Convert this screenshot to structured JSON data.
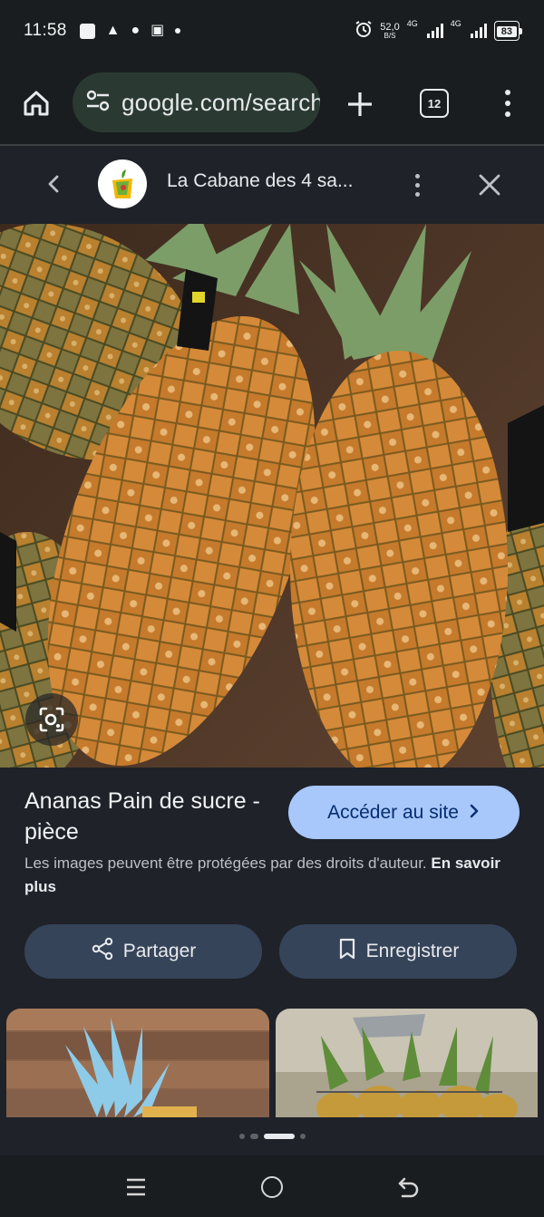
{
  "status_bar": {
    "time": "11:58",
    "net_speed_value": "52,0",
    "net_speed_unit": "B/S",
    "sim1_label": "4G",
    "sim2_label": "4G",
    "battery": "83"
  },
  "browser": {
    "url": "google.com/search",
    "tab_count": "12"
  },
  "viewer": {
    "site_name": "La Cabane des 4 sa..."
  },
  "result": {
    "title": "Ananas Pain de sucre - pièce",
    "visit_label": "Accéder au site",
    "copyright_text": "Les images peuvent être protégées par des droits d'auteur.",
    "learn_more_label": "En savoir plus",
    "share_label": "Partager",
    "save_label": "Enregistrer"
  },
  "colors": {
    "accent_button": "#a8c7fa",
    "secondary_button": "#36445a",
    "background": "#1f2229"
  },
  "icons": {
    "home": "home-icon",
    "site_settings": "tune-icon",
    "new_tab": "plus-icon",
    "tabs": "tabs-counter-icon",
    "menu": "more-vertical-icon",
    "back": "chevron-left-icon",
    "close": "close-icon",
    "lens": "lens-icon",
    "share": "share-icon",
    "save": "bookmark-icon"
  }
}
